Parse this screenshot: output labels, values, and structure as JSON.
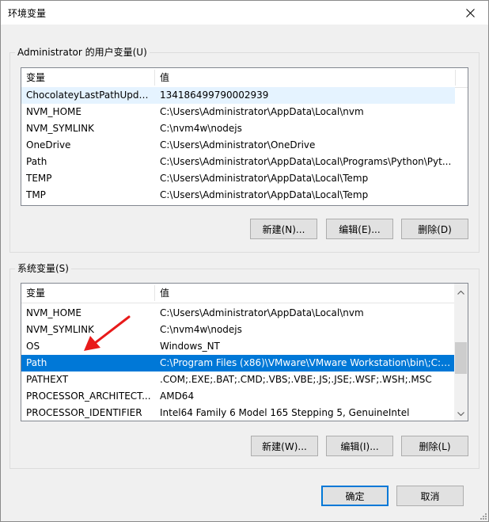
{
  "window": {
    "title": "环境变量"
  },
  "user_vars": {
    "group_label": "Administrator 的用户变量(U)",
    "columns": [
      "变量",
      "值"
    ],
    "rows": [
      {
        "name": "ChocolateyLastPathUpdate",
        "value": "134186499790002939"
      },
      {
        "name": "NVM_HOME",
        "value": "C:\\Users\\Administrator\\AppData\\Local\\nvm"
      },
      {
        "name": "NVM_SYMLINK",
        "value": "C:\\nvm4w\\nodejs"
      },
      {
        "name": "OneDrive",
        "value": "C:\\Users\\Administrator\\OneDrive"
      },
      {
        "name": "Path",
        "value": "C:\\Users\\Administrator\\AppData\\Local\\Programs\\Python\\Pyt..."
      },
      {
        "name": "TEMP",
        "value": "C:\\Users\\Administrator\\AppData\\Local\\Temp"
      },
      {
        "name": "TMP",
        "value": "C:\\Users\\Administrator\\AppData\\Local\\Temp"
      }
    ],
    "buttons": {
      "new": "新建(N)...",
      "edit": "编辑(E)...",
      "delete": "删除(D)"
    }
  },
  "system_vars": {
    "group_label": "系统变量(S)",
    "columns": [
      "变量",
      "值"
    ],
    "rows": [
      {
        "name": "NVM_HOME",
        "value": "C:\\Users\\Administrator\\AppData\\Local\\nvm"
      },
      {
        "name": "NVM_SYMLINK",
        "value": "C:\\nvm4w\\nodejs"
      },
      {
        "name": "OS",
        "value": "Windows_NT"
      },
      {
        "name": "Path",
        "value": "C:\\Program Files (x86)\\VMware\\VMware Workstation\\bin\\;C:\\..."
      },
      {
        "name": "PATHEXT",
        "value": ".COM;.EXE;.BAT;.CMD;.VBS;.VBE;.JS;.JSE;.WSF;.WSH;.MSC"
      },
      {
        "name": "PROCESSOR_ARCHITECT...",
        "value": "AMD64"
      },
      {
        "name": "PROCESSOR_IDENTIFIER",
        "value": "Intel64 Family 6 Model 165 Stepping 5, GenuineIntel"
      }
    ],
    "buttons": {
      "new": "新建(W)...",
      "edit": "编辑(I)...",
      "delete": "删除(L)"
    }
  },
  "footer": {
    "ok": "确定",
    "cancel": "取消"
  },
  "colors": {
    "selection": "#0078d7",
    "hover": "#e5f3ff",
    "annotation_arrow": "#e81a1a"
  }
}
